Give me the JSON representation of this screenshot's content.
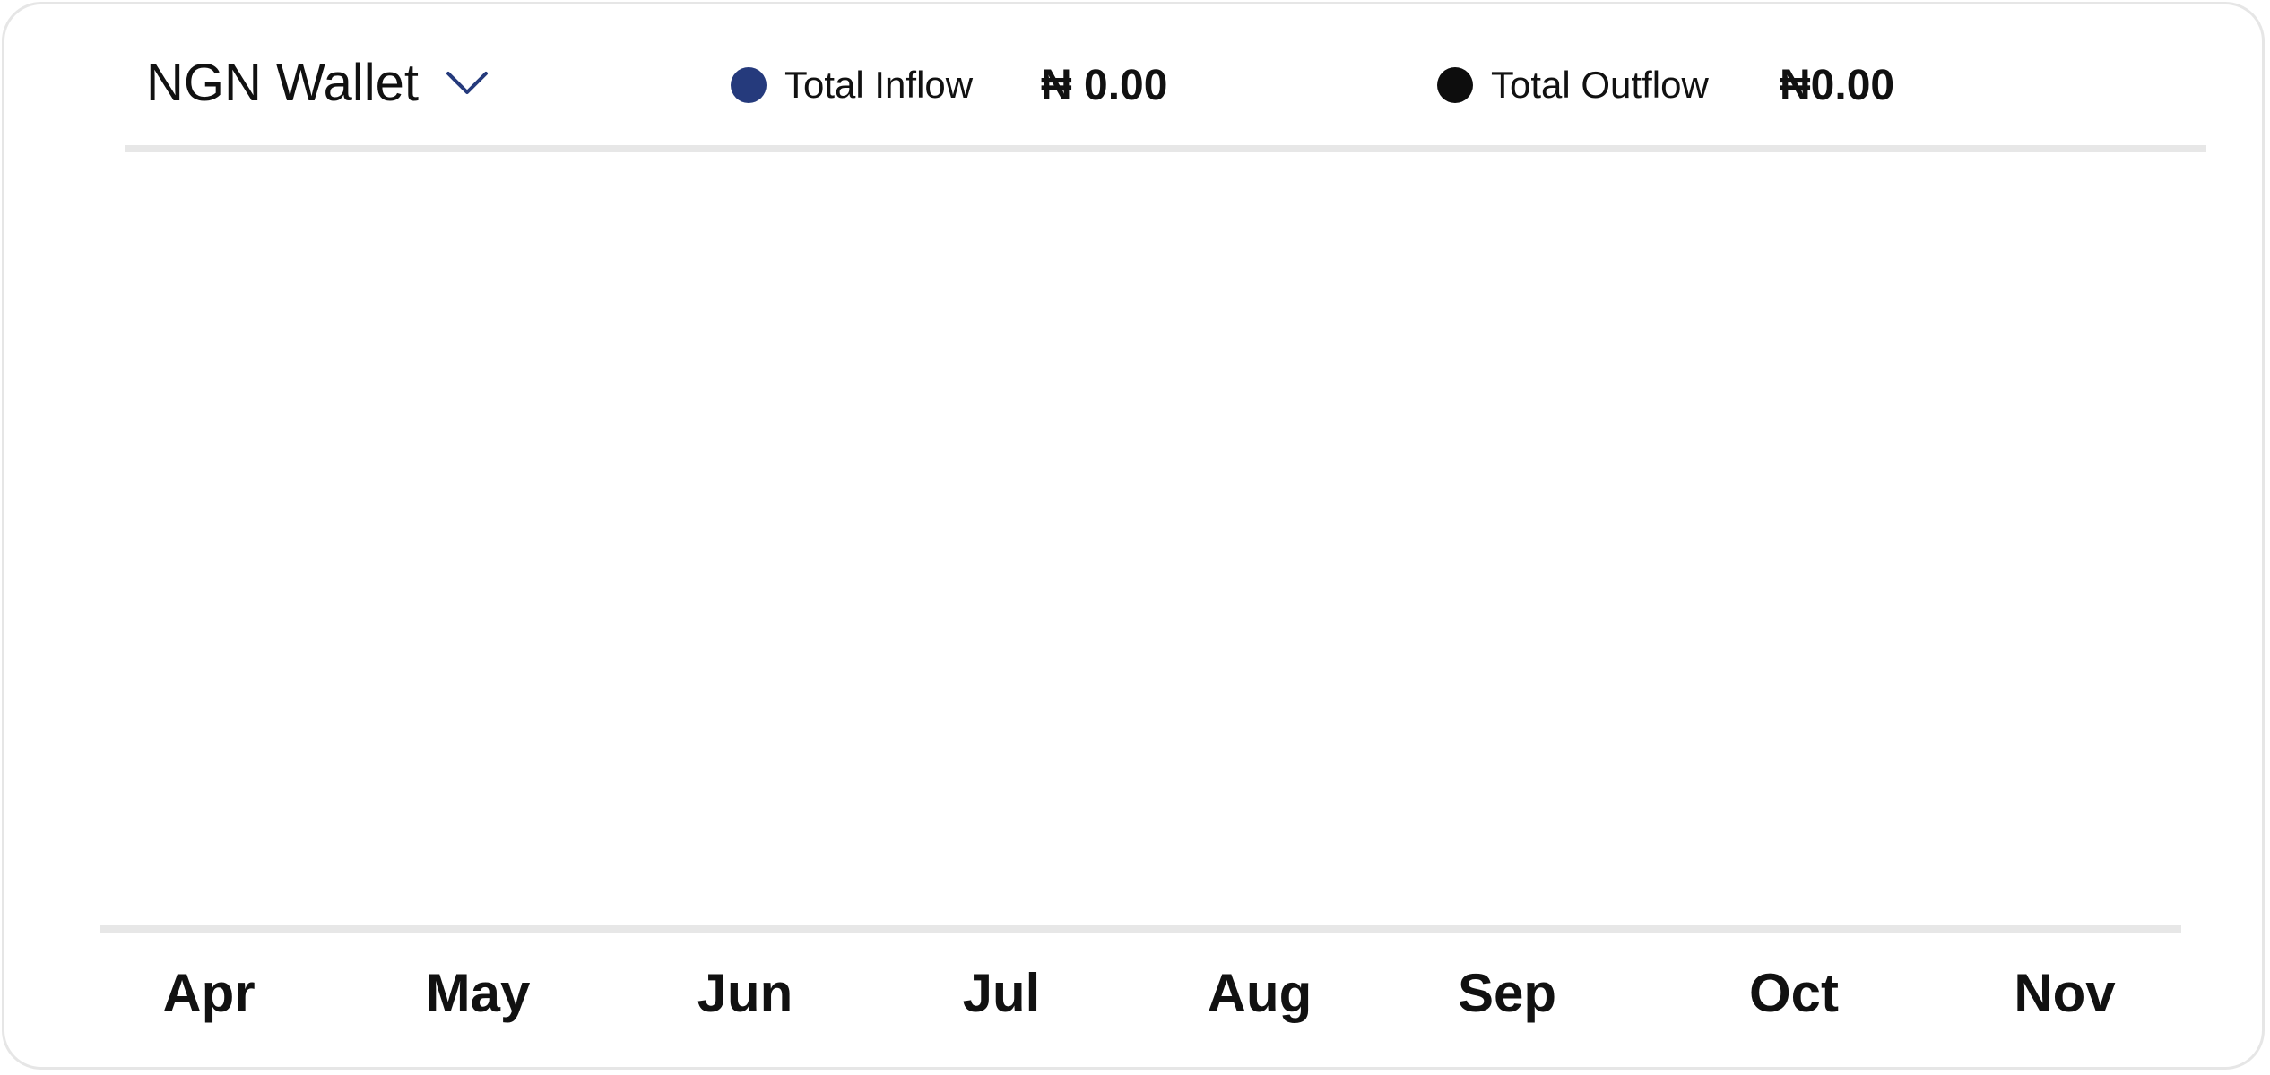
{
  "wallet_selector": {
    "label": "NGN Wallet",
    "icon": "chevron-down-icon"
  },
  "legend": {
    "inflow": {
      "label": "Total Inflow",
      "value": "₦ 0.00",
      "color": "#253a7c"
    },
    "outflow": {
      "label": "Total Outflow",
      "value": "₦0.00",
      "color": "#0d0d0d"
    }
  },
  "chart_data": {
    "type": "bar",
    "categories": [
      "Apr",
      "May",
      "Jun",
      "Jul",
      "Aug",
      "Sep",
      "Oct",
      "Nov"
    ],
    "series": [
      {
        "name": "Total Inflow",
        "values": [
          0,
          0,
          0,
          0,
          0,
          0,
          0,
          0
        ]
      },
      {
        "name": "Total Outflow",
        "values": [
          0,
          0,
          0,
          0,
          0,
          0,
          0,
          0
        ]
      }
    ],
    "grid": false
  }
}
